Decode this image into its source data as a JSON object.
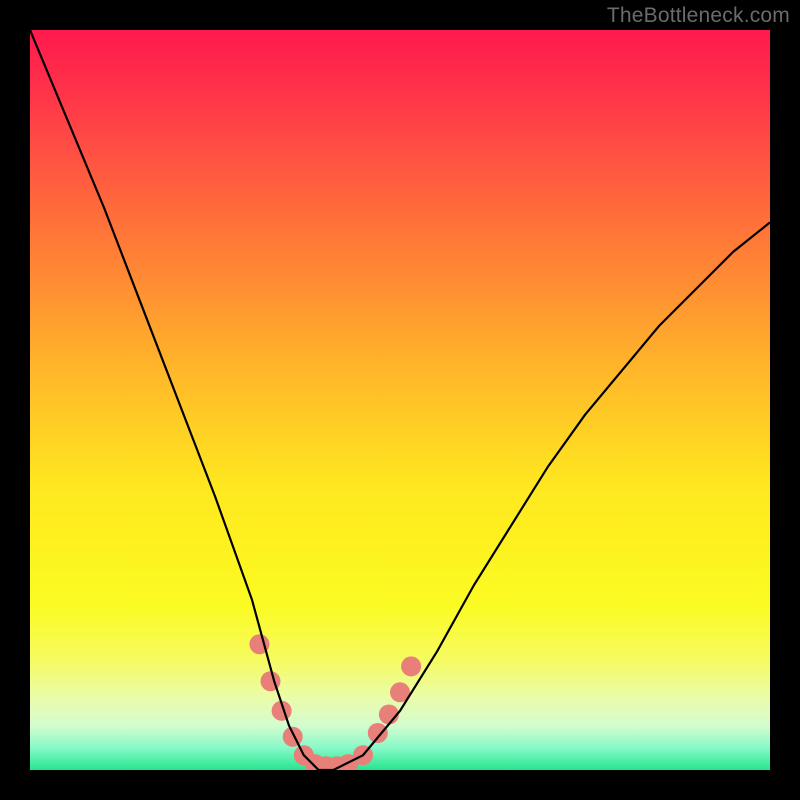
{
  "watermark": "TheBottleneck.com",
  "chart_data": {
    "type": "line",
    "title": "",
    "xlabel": "",
    "ylabel": "",
    "xlim": [
      0,
      100
    ],
    "ylim": [
      0,
      100
    ],
    "grid": false,
    "legend": false,
    "series": [
      {
        "name": "bottleneck-curve",
        "x": [
          0,
          5,
          10,
          15,
          20,
          25,
          30,
          33,
          35,
          37,
          39,
          41,
          45,
          50,
          55,
          60,
          65,
          70,
          75,
          80,
          85,
          90,
          95,
          100
        ],
        "y": [
          100,
          88,
          76,
          63,
          50,
          37,
          23,
          12,
          6,
          2,
          0,
          0,
          2,
          8,
          16,
          25,
          33,
          41,
          48,
          54,
          60,
          65,
          70,
          74
        ],
        "color": "#000000"
      }
    ],
    "markers": [
      {
        "name": "valley-highlight",
        "color": "#e88079",
        "points": [
          {
            "x": 31,
            "y": 17
          },
          {
            "x": 32.5,
            "y": 12
          },
          {
            "x": 34,
            "y": 8
          },
          {
            "x": 35.5,
            "y": 4.5
          },
          {
            "x": 37,
            "y": 2
          },
          {
            "x": 38.5,
            "y": 0.8
          },
          {
            "x": 40,
            "y": 0.5
          },
          {
            "x": 41.5,
            "y": 0.5
          },
          {
            "x": 43,
            "y": 0.8
          },
          {
            "x": 45,
            "y": 2
          },
          {
            "x": 47,
            "y": 5
          },
          {
            "x": 48.5,
            "y": 7.5
          },
          {
            "x": 50,
            "y": 10.5
          },
          {
            "x": 51.5,
            "y": 14
          }
        ]
      }
    ],
    "background_gradient": {
      "stops": [
        {
          "pos": 0,
          "color": "#ff1a4d"
        },
        {
          "pos": 20,
          "color": "#ff5a40"
        },
        {
          "pos": 40,
          "color": "#ff9a30"
        },
        {
          "pos": 60,
          "color": "#ffe020"
        },
        {
          "pos": 80,
          "color": "#faf850"
        },
        {
          "pos": 95,
          "color": "#c8fbc0"
        },
        {
          "pos": 100,
          "color": "#27e58f"
        }
      ]
    }
  }
}
